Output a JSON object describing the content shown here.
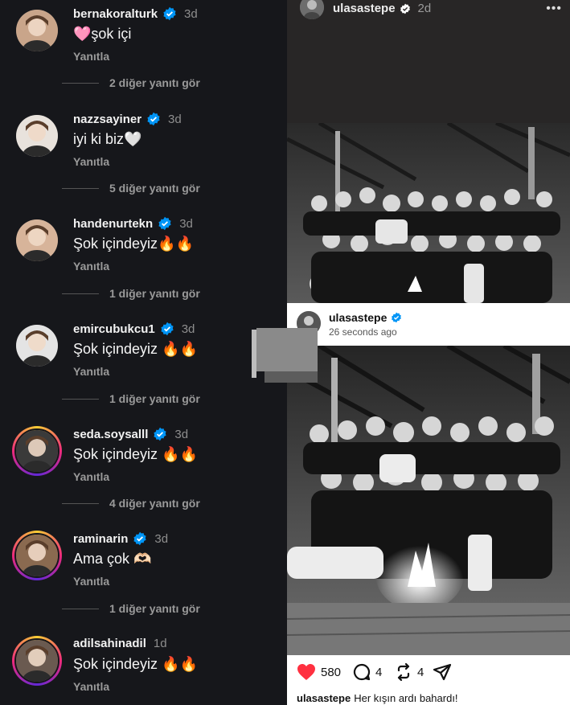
{
  "comments": [
    {
      "username": "bernakoralturk",
      "time": "3d",
      "text": "🩷şok içi",
      "reply": "Yanıtla",
      "more": "2 diğer yanıtı gör",
      "verified": true,
      "ring": false
    },
    {
      "username": "nazzsayiner",
      "time": "3d",
      "text": "iyi ki biz🤍",
      "reply": "Yanıtla",
      "more": "5 diğer yanıtı gör",
      "verified": true,
      "ring": false
    },
    {
      "username": "handenurtekn",
      "time": "3d",
      "text": "Şok içindeyiz🔥🔥",
      "reply": "Yanıtla",
      "more": "1 diğer yanıtı gör",
      "verified": true,
      "ring": false
    },
    {
      "username": "emircubukcu1",
      "time": "3d",
      "text": "Şok içindeyiz 🔥🔥",
      "reply": "Yanıtla",
      "more": "1 diğer yanıtı gör",
      "verified": true,
      "ring": false
    },
    {
      "username": "seda.soysalll",
      "time": "3d",
      "text": "Şok içindeyiz 🔥🔥",
      "reply": "Yanıtla",
      "more": "4 diğer yanıtı gör",
      "verified": true,
      "ring": true
    },
    {
      "username": "raminarin",
      "time": "3d",
      "text": "Ama çok 🫶🏻",
      "reply": "Yanıtla",
      "more": "1 diğer yanıtı gör",
      "verified": true,
      "ring": true
    },
    {
      "username": "adilsahinadil",
      "time": "1d",
      "text": "Şok içindeyiz 🔥🔥",
      "reply": "Yanıtla",
      "more": "",
      "verified": false,
      "ring": true
    }
  ],
  "post": {
    "username": "ulasastepe",
    "time": "2d",
    "more_icon": "more-dots-icon",
    "repost": {
      "username": "ulasastepe",
      "time": "26 seconds ago"
    },
    "likes": "580",
    "comments": "4",
    "reposts": "4",
    "caption_user": "ulasastepe",
    "caption_text": "Her kışın ardı bahardı!"
  },
  "colors": {
    "background": "#16171b",
    "verified_blue": "#0095f6",
    "like_red": "#ff3040",
    "text_muted": "#9a9a9a"
  }
}
